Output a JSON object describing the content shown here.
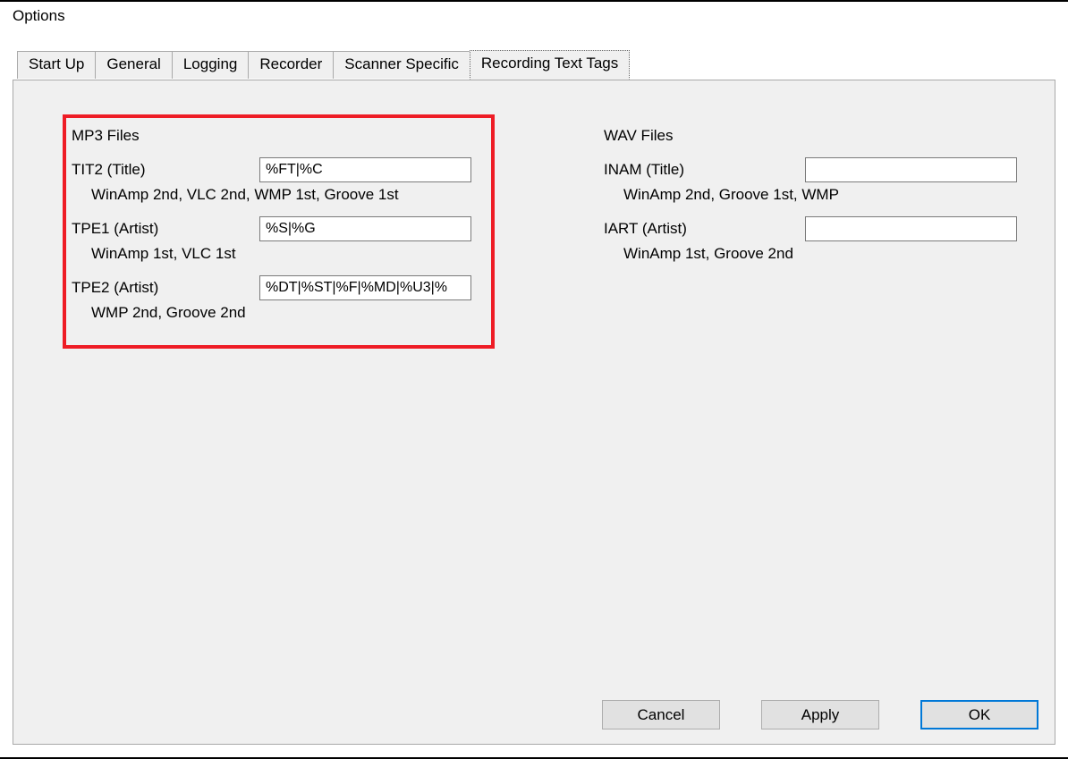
{
  "window": {
    "title": "Options"
  },
  "tabs": [
    {
      "label": "Start Up",
      "active": false
    },
    {
      "label": "General",
      "active": false
    },
    {
      "label": "Logging",
      "active": false
    },
    {
      "label": "Recorder",
      "active": false
    },
    {
      "label": "Scanner Specific",
      "active": false
    },
    {
      "label": "Recording Text Tags",
      "active": true
    }
  ],
  "mp3": {
    "heading": "MP3 Files",
    "tit2": {
      "label": "TIT2 (Title)",
      "value": "%FT|%C",
      "hint": "WinAmp 2nd, VLC 2nd, WMP 1st, Groove 1st"
    },
    "tpe1": {
      "label": "TPE1 (Artist)",
      "value": "%S|%G",
      "hint": "WinAmp 1st, VLC 1st"
    },
    "tpe2": {
      "label": "TPE2 (Artist)",
      "value": "%DT|%ST|%F|%MD|%U3|%",
      "hint": "WMP 2nd, Groove 2nd"
    }
  },
  "wav": {
    "heading": "WAV Files",
    "inam": {
      "label": "INAM (Title)",
      "value": "",
      "hint": "WinAmp 2nd, Groove 1st, WMP"
    },
    "iart": {
      "label": "IART (Artist)",
      "value": "",
      "hint": "WinAmp 1st, Groove 2nd"
    }
  },
  "buttons": {
    "cancel": "Cancel",
    "apply": "Apply",
    "ok": "OK"
  },
  "colors": {
    "highlight": "#ee1c25",
    "focus": "#0078d7"
  }
}
